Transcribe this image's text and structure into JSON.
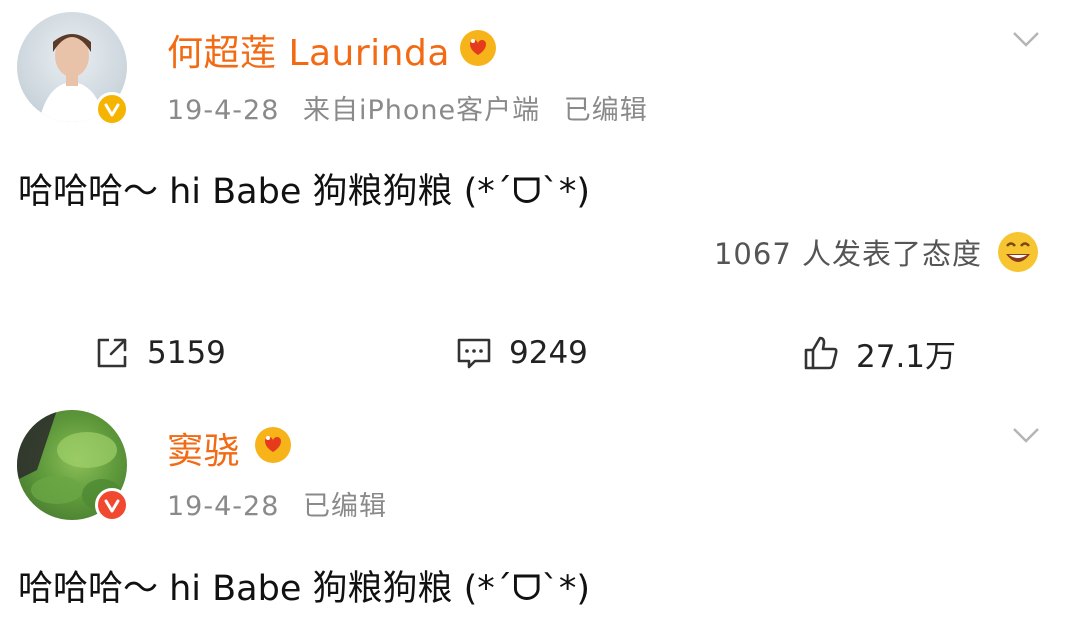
{
  "posts": [
    {
      "username": "何超莲 Laurinda",
      "date": "19-4-28",
      "source": "来自iPhone客户端",
      "edited": "已编辑",
      "text": "哈哈哈～ hi Babe 狗粮狗粮 (*ˊᗜˋ*)",
      "reactions_text": "1067 人发表了态度",
      "actions": {
        "repost_count": "5159",
        "comment_count": "9249",
        "like_count": "27.1万"
      }
    },
    {
      "username": "窦骁",
      "date": "19-4-28",
      "edited": "已编辑",
      "text": "哈哈哈～ hi Babe 狗粮狗粮 (*ˊᗜˋ*)"
    }
  ],
  "colors": {
    "username": "#f26a13",
    "meta": "#8a8a8a",
    "badge_gold": "#f5b400",
    "badge_red": "#f0492f"
  },
  "icons": [
    "verified-badge-icon",
    "vip-heart-icon",
    "chevron-down-icon",
    "laugh-emoji-icon",
    "repost-icon",
    "comment-icon",
    "like-icon"
  ]
}
